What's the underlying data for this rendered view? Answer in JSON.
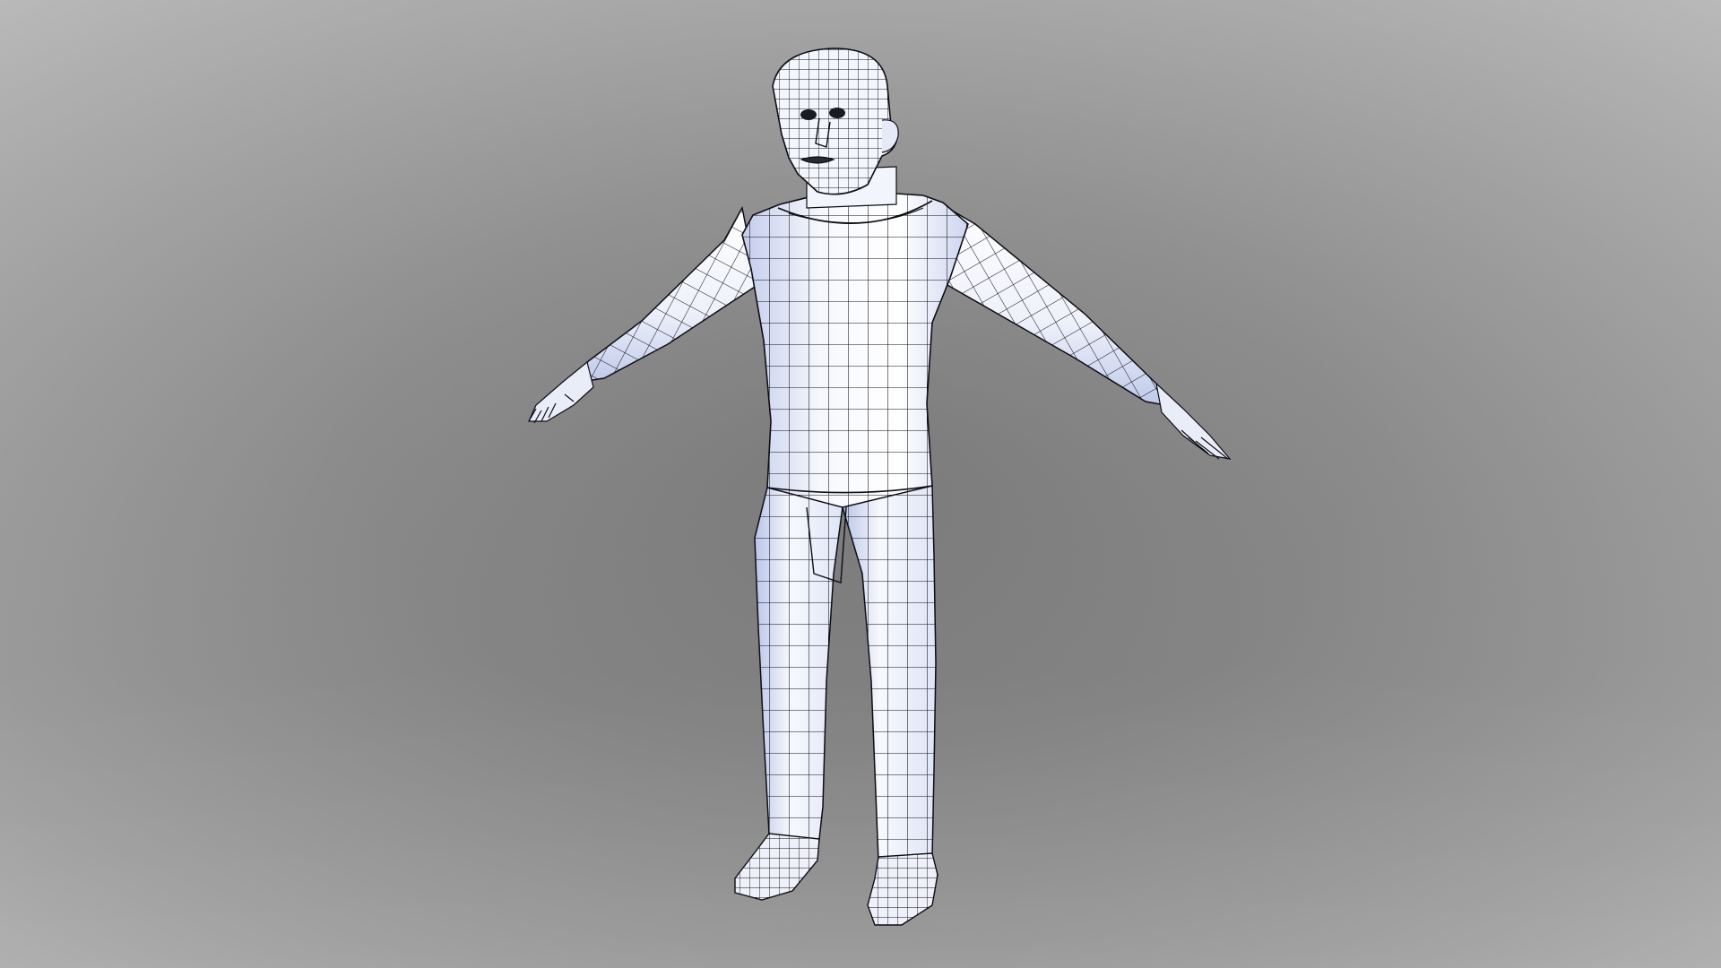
{
  "scene": {
    "subject": "wireframe-humanoid-t-pose",
    "colors": {
      "background_center": "#7c7c7c",
      "background_edge": "#b4b4b4",
      "mesh_fill": "#f4f7fb",
      "mesh_shade": "#b8c4e6",
      "wire": "#0d0d14"
    }
  }
}
